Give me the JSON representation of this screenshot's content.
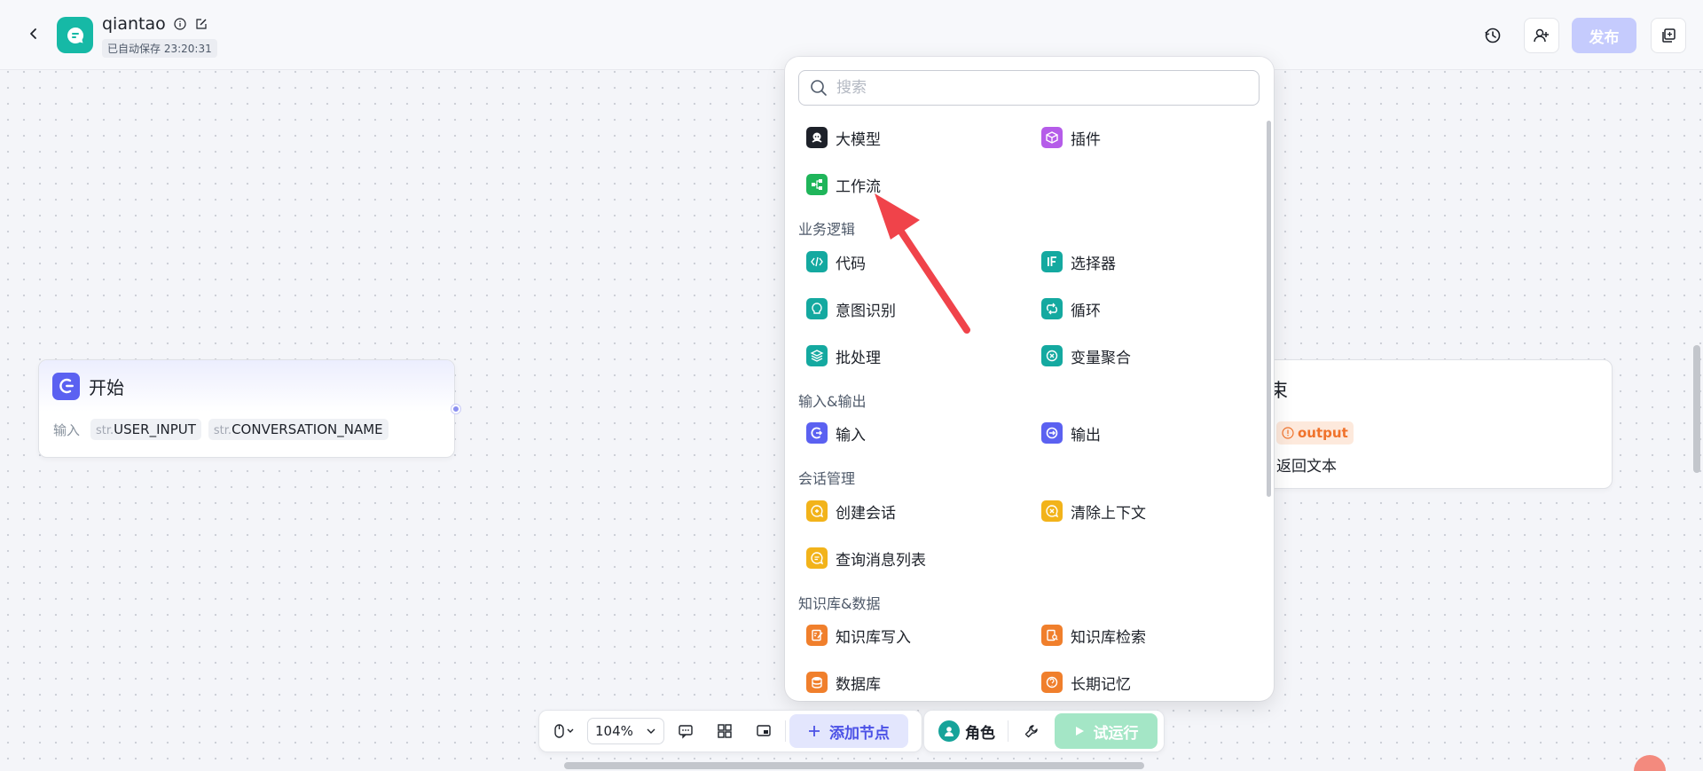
{
  "header": {
    "back_icon": "chevron-left-icon",
    "app_name": "qiantao",
    "autosave": "已自动保存 23:20:31",
    "publish_label": "发布",
    "icons": [
      "history-icon",
      "add-collaborator-icon",
      "copy-icon"
    ]
  },
  "start_node": {
    "title": "开始",
    "input_label": "输入",
    "params": [
      {
        "type": "str.",
        "name": "USER_INPUT"
      },
      {
        "type": "str.",
        "name": "CONVERSATION_NAME"
      }
    ]
  },
  "end_node": {
    "title_fragment": "束",
    "output_tag": "output",
    "text": "返回文本"
  },
  "popup": {
    "search_placeholder": "搜索",
    "top_items": [
      {
        "label": "大模型",
        "icon": "llm-icon",
        "color": "#1d2129"
      },
      {
        "label": "插件",
        "icon": "plugin-icon",
        "color": "#b55ce9"
      },
      {
        "label": "工作流",
        "icon": "workflow-icon",
        "color": "#1fb55a"
      }
    ],
    "sections": [
      {
        "title": "业务逻辑",
        "items": [
          {
            "label": "代码",
            "icon": "code-icon",
            "color": "#14a9a0"
          },
          {
            "label": "选择器",
            "icon": "condition-icon",
            "color": "#14a9a0"
          },
          {
            "label": "意图识别",
            "icon": "intent-icon",
            "color": "#14a9a0"
          },
          {
            "label": "循环",
            "icon": "loop-icon",
            "color": "#14a9a0"
          },
          {
            "label": "批处理",
            "icon": "batch-icon",
            "color": "#14a9a0"
          },
          {
            "label": "变量聚合",
            "icon": "variable-merge-icon",
            "color": "#14a9a0"
          }
        ]
      },
      {
        "title": "输入&输出",
        "items": [
          {
            "label": "输入",
            "icon": "input-icon",
            "color": "#5b61f1"
          },
          {
            "label": "输出",
            "icon": "output-icon",
            "color": "#5b61f1"
          }
        ]
      },
      {
        "title": "会话管理",
        "items": [
          {
            "label": "创建会话",
            "icon": "create-conversation-icon",
            "color": "#f2b31a"
          },
          {
            "label": "清除上下文",
            "icon": "clear-context-icon",
            "color": "#f2b31a"
          },
          {
            "label": "查询消息列表",
            "icon": "message-list-icon",
            "color": "#f2b31a"
          }
        ]
      },
      {
        "title": "知识库&数据",
        "items": [
          {
            "label": "知识库写入",
            "icon": "knowledge-write-icon",
            "color": "#f07f2c"
          },
          {
            "label": "知识库检索",
            "icon": "knowledge-search-icon",
            "color": "#f07f2c"
          },
          {
            "label": "数据库",
            "icon": "database-icon",
            "color": "#f07f2c"
          },
          {
            "label": "长期记忆",
            "icon": "memory-icon",
            "color": "#f07f2c"
          }
        ]
      }
    ]
  },
  "toolbar": {
    "zoom": "104%",
    "add_node_label": "添加节点",
    "role_label": "角色",
    "run_label": "试运行"
  },
  "colors": {
    "accent": "#5b61f1",
    "brand": "#16b9a6",
    "annotation_arrow": "#f0434a"
  }
}
